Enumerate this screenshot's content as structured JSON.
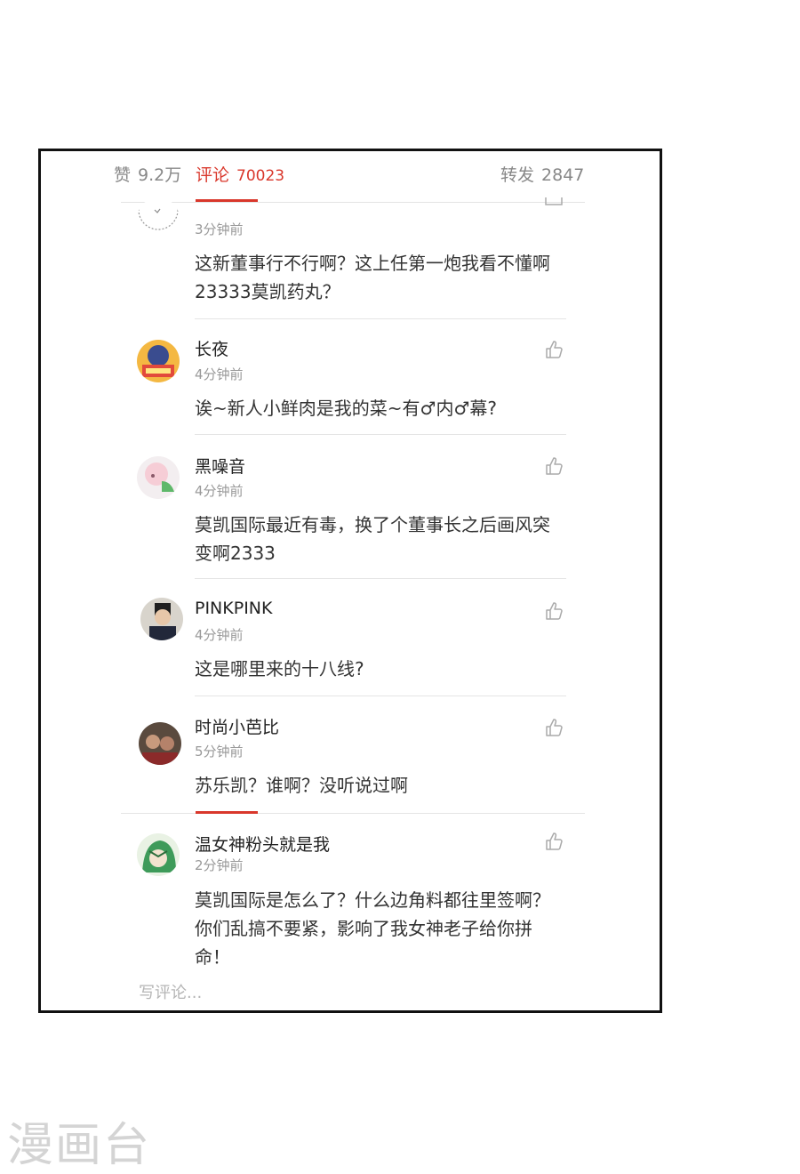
{
  "tabs": {
    "likes_label": "赞",
    "likes_count": "9.2万",
    "comments_label": "评论",
    "comments_count": "70023",
    "reposts_label": "转发",
    "reposts_count": "2847",
    "active_color": "#d9372b"
  },
  "comments": [
    {
      "name": "",
      "time": "3分钟前",
      "text": "这新董事行不行啊？这上任第一炮我看不懂啊23333莫凯药丸？",
      "avatar": "sketch-avatar"
    },
    {
      "name": "长夜",
      "time": "4分钟前",
      "text": "诶~新人小鲜肉是我的菜~有♂内♂幕?",
      "avatar": "cartoon-avatar"
    },
    {
      "name": "黑噪音",
      "time": "4分钟前",
      "text": "莫凯国际最近有毒，换了个董事长之后画风突变啊2333",
      "avatar": "anime-girl-avatar"
    },
    {
      "name": "PINKPINK",
      "time": "4分钟前",
      "text": "这是哪里来的十八线?",
      "avatar": "man-portrait-avatar"
    },
    {
      "name": "时尚小芭比",
      "time": "5分钟前",
      "text": "苏乐凯？谁啊？没听说过啊",
      "avatar": "couple-avatar"
    },
    {
      "name": "温女神粉头就是我",
      "time": "2分钟前",
      "text": "莫凯国际是怎么了？什么边角料都往里签啊？你们乱搞不要紧，影响了我女神老子给你拼命！",
      "avatar": "green-hair-avatar"
    }
  ],
  "comment_input": {
    "placeholder": "写评论..."
  },
  "watermark": "漫画台"
}
